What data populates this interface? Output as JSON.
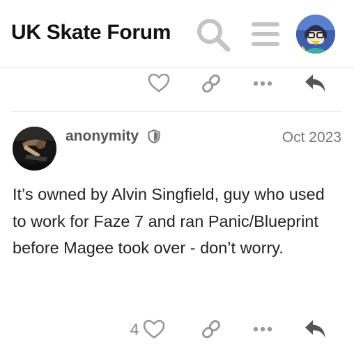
{
  "header": {
    "title": "UK Skate Forum",
    "search_icon": "search-icon",
    "menu_icon": "hamburger-menu-icon",
    "avatar_icon": "user-avatar"
  },
  "colors": {
    "icon_gray": "#c4c4c4",
    "action_gray": "#9a9a9a",
    "reply_dark": "#555555",
    "text": "#222222",
    "muted": "#777777"
  },
  "previous_post_actions": {
    "like_icon": "heart-icon",
    "link_icon": "link-icon",
    "more_icon": "ellipsis-icon",
    "reply_icon": "reply-arrow-icon"
  },
  "post": {
    "username": "anonymity",
    "badge_icon": "shield-icon",
    "date": "Oct 2023",
    "body": "It’s owned by Alvin Singfield, guy who used to work for Faze 7 and ran Panic/Blueprint before Magee took over - don’t worry.",
    "like_count": "4"
  }
}
